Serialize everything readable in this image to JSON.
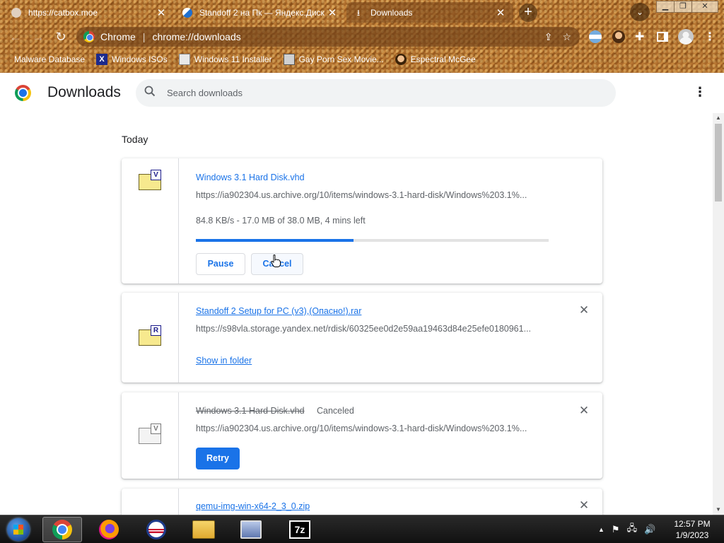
{
  "tabs": [
    {
      "title": "https://catbox.moe",
      "active": false
    },
    {
      "title": "Standoff 2 на Пк — Яндекс.Диск",
      "active": false
    },
    {
      "title": "Downloads",
      "active": true
    }
  ],
  "omnibox": {
    "site_label": "Chrome",
    "url": "chrome://downloads"
  },
  "bookmarks": [
    {
      "label": "Malware Database",
      "icon": "malware-database-icon"
    },
    {
      "label": "Windows ISOs",
      "icon": "x-logo-icon"
    },
    {
      "label": "Windows 11 Installer",
      "icon": "image-icon"
    },
    {
      "label": "Gay Porn Sex Movie...",
      "icon": "computer-icon"
    },
    {
      "label": "Espectral McGee",
      "icon": "avatar-icon"
    }
  ],
  "page": {
    "title": "Downloads",
    "search_placeholder": "Search downloads",
    "section_title": "Today"
  },
  "downloads": [
    {
      "filename": "Windows 3.1 Hard Disk.vhd",
      "url": "https://ia902304.us.archive.org/10/items/windows-3.1-hard-disk/Windows%203.1%...",
      "progress_text": "84.8 KB/s - 17.0 MB of 38.0 MB, 4 mins left",
      "progress_fraction": 0.4474,
      "state": "in-progress",
      "icon_letter": "V",
      "buttons": [
        "Pause",
        "Cancel"
      ]
    },
    {
      "filename": "Standoff 2 Setup for PC (v3),(Опасно!).rar",
      "url": "https://s98vla.storage.yandex.net/rdisk/60325ee0d2e59aa19463d84e25efe0180961...",
      "state": "complete",
      "icon_letter": "R",
      "action_link": "Show in folder"
    },
    {
      "filename": "Windows 3.1 Hard Disk.vhd",
      "status": "Canceled",
      "url": "https://ia902304.us.archive.org/10/items/windows-3.1-hard-disk/Windows%203.1%...",
      "state": "canceled",
      "icon_letter": "V",
      "button": "Retry"
    },
    {
      "filename": "qemu-img-win-x64-2_3_0.zip",
      "state": "partial-visible"
    }
  ],
  "taskbar": {
    "apps": [
      "chrome",
      "firefox",
      "obama-logo",
      "file-explorer",
      "computer",
      "7zip"
    ],
    "seven_zip_label": "7z",
    "clock_time": "12:57 PM",
    "clock_date": "1/9/2023"
  },
  "colors": {
    "accent": "#1a73e8",
    "frame": "#b87733"
  }
}
